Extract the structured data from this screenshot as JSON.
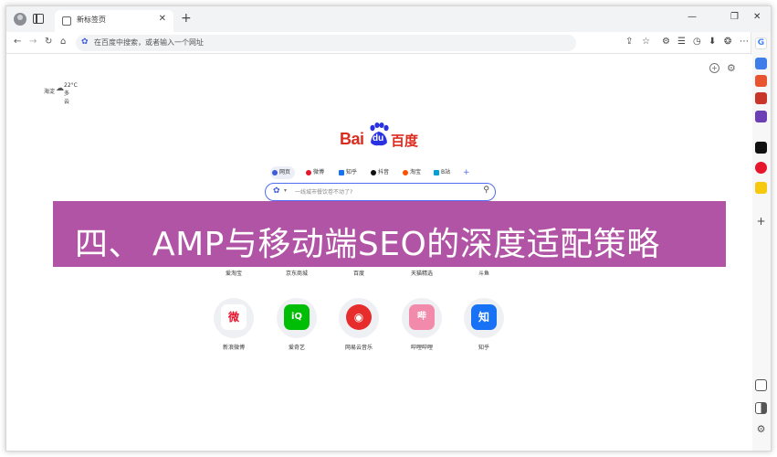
{
  "browser": {
    "tab_title": "新标签页",
    "tab_close": "✕",
    "new_tab": "+",
    "window_controls": [
      "—",
      "❐",
      "✕"
    ],
    "nav": [
      "←",
      "→",
      "↻",
      "⌂"
    ],
    "address_placeholder": "在百度中搜索，或者输入一个网址",
    "toolbar_icons": [
      "share-icon",
      "star-icon",
      "extensions-icon",
      "favorites-icon",
      "history-icon",
      "download-icon",
      "copilot-icon",
      "more-icon"
    ],
    "toolbar_glyphs": [
      "⇪",
      "☆",
      "⚙",
      "☰",
      "◷",
      "⬇",
      "❂",
      "⋯"
    ]
  },
  "weather": {
    "city": "海淀",
    "temp": "22°C",
    "condition": "多云"
  },
  "page_controls": {
    "add": "+",
    "settings": "⚙"
  },
  "search": {
    "tabs": [
      {
        "label": "网页",
        "color": "#3e5bd9"
      },
      {
        "label": "微博",
        "color": "#e6162d"
      },
      {
        "label": "知乎",
        "color": "#1772f6"
      },
      {
        "label": "抖音",
        "color": "#111111"
      },
      {
        "label": "淘宝",
        "color": "#ff5000"
      },
      {
        "label": "B站",
        "color": "#00a1d6"
      }
    ],
    "plus": "+",
    "placeholder": "一线城市餐饮卷不动了?"
  },
  "banner": {
    "text": "四、 AMP与移动端SEO的深度适配策略",
    "background": "#b254a5"
  },
  "top_sites_row1": [
    "爱淘宝",
    "京东商城",
    "百度",
    "天猫精选",
    "斗鱼"
  ],
  "top_sites_row2": [
    {
      "label": "新浪微博",
      "glyph": "微",
      "color": "#e6162d"
    },
    {
      "label": "爱奇艺",
      "glyph": "iQ",
      "color": "#00be06"
    },
    {
      "label": "网易云音乐",
      "glyph": "◉",
      "color": "#e72d2c"
    },
    {
      "label": "哔哩哔哩",
      "glyph": "哔",
      "color": "#f28aab"
    },
    {
      "label": "知乎",
      "glyph": "知",
      "color": "#1772f6"
    }
  ]
}
